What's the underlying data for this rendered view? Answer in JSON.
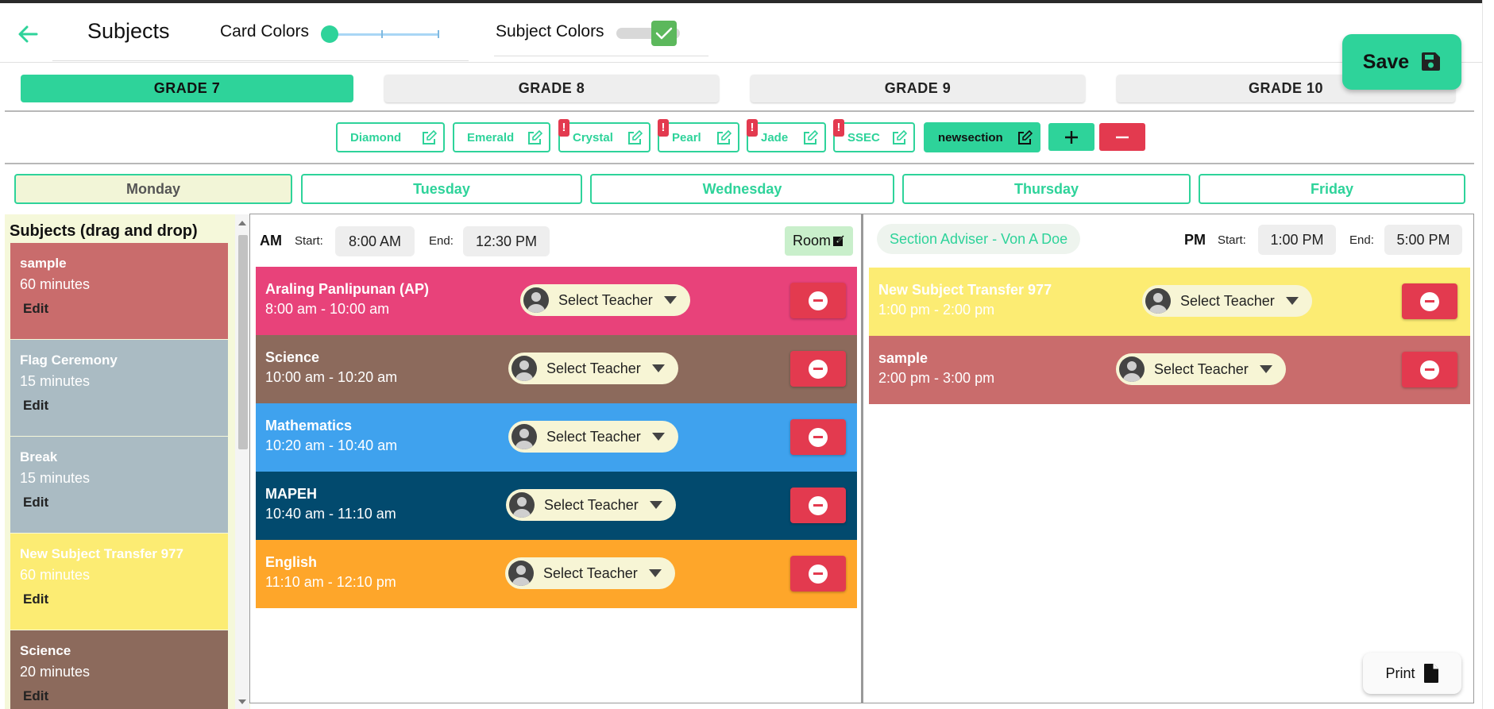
{
  "header": {
    "title": "Subjects",
    "card_colors_label": "Card Colors",
    "card_colors_level": 0,
    "subject_colors_label": "Subject Colors",
    "subject_colors_on": true,
    "save_label": "Save"
  },
  "grades": [
    {
      "label": "GRADE 7",
      "active": true
    },
    {
      "label": "GRADE 8",
      "active": false
    },
    {
      "label": "GRADE 9",
      "active": false
    },
    {
      "label": "GRADE 10",
      "active": false
    }
  ],
  "sections": [
    {
      "label": "Diamond",
      "warning": false,
      "selected": false
    },
    {
      "label": "Emerald",
      "warning": false,
      "selected": false
    },
    {
      "label": "Crystal",
      "warning": true,
      "selected": false
    },
    {
      "label": "Pearl",
      "warning": true,
      "selected": false
    },
    {
      "label": "Jade",
      "warning": true,
      "selected": false
    },
    {
      "label": "SSEC",
      "warning": true,
      "selected": false
    },
    {
      "label": "newsection",
      "warning": false,
      "selected": true
    }
  ],
  "warning_mark": "!",
  "days": [
    {
      "label": "Monday",
      "active": true
    },
    {
      "label": "Tuesday",
      "active": false
    },
    {
      "label": "Wednesday",
      "active": false
    },
    {
      "label": "Thursday",
      "active": false
    },
    {
      "label": "Friday",
      "active": false
    }
  ],
  "sidebar": {
    "title": "Subjects (drag and drop)",
    "edit_label": "Edit",
    "subjects": [
      {
        "name": "sample",
        "duration": "60 minutes",
        "color": "#c96c6c"
      },
      {
        "name": "Flag Ceremony",
        "duration": "15 minutes",
        "color": "#aabbc3"
      },
      {
        "name": "Break",
        "duration": "15 minutes",
        "color": "#aabbc3"
      },
      {
        "name": "New Subject Transfer 977",
        "duration": "60 minutes",
        "color": "#fcec73"
      },
      {
        "name": "Science",
        "duration": "20 minutes",
        "color": "#8c6a5c"
      }
    ]
  },
  "am": {
    "period": "AM",
    "start_label": "Start:",
    "start_value": "8:00 AM",
    "end_label": "End:",
    "end_value": "12:30 PM",
    "room_label": "Room",
    "rows": [
      {
        "name": "Araling Panlipunan (AP)",
        "time": "8:00 am - 10:00 am",
        "teacher": "Select Teacher",
        "color": "#e8427a"
      },
      {
        "name": "Science",
        "time": "10:00 am - 10:20 am",
        "teacher": "Select Teacher",
        "color": "#8c6a5c"
      },
      {
        "name": "Mathematics",
        "time": "10:20 am - 10:40 am",
        "teacher": "Select Teacher",
        "color": "#3fa2ee"
      },
      {
        "name": "MAPEH",
        "time": "10:40 am - 11:10 am",
        "teacher": "Select Teacher",
        "color": "#024a6e"
      },
      {
        "name": "English",
        "time": "11:10 am - 12:10 pm",
        "teacher": "Select Teacher",
        "color": "#fea62a"
      }
    ]
  },
  "pm": {
    "adviser": "Section Adviser - Von A Doe",
    "period": "PM",
    "start_label": "Start:",
    "start_value": "1:00 PM",
    "end_label": "End:",
    "end_value": "5:00 PM",
    "rows": [
      {
        "name": "New Subject Transfer 977",
        "time": "1:00 pm - 2:00 pm",
        "teacher": "Select Teacher",
        "color": "#fcec73"
      },
      {
        "name": "sample",
        "time": "2:00 pm - 3:00 pm",
        "teacher": "Select Teacher",
        "color": "#c96c6c"
      }
    ]
  },
  "print_label": "Print",
  "colors": {
    "accent": "#2ed39a",
    "danger": "#e33a4f"
  },
  "icons": [
    "back-arrow-icon",
    "save-disk-icon",
    "edit-icon",
    "plus-icon",
    "minus-icon",
    "user-avatar-icon",
    "chevron-down-icon",
    "print-file-icon",
    "checkmark-icon"
  ]
}
